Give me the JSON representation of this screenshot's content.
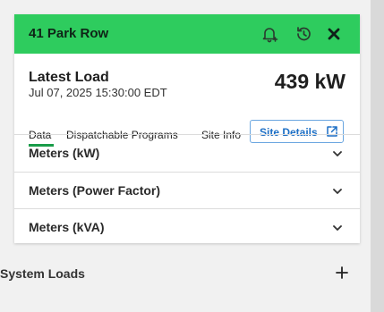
{
  "header": {
    "title": "41 Park Row",
    "accent_color": "#2ecc5e",
    "icons": [
      "bell-plus-icon",
      "history-icon",
      "close-icon"
    ]
  },
  "latest_load": {
    "title": "Latest Load",
    "timestamp": "Jul 07, 2025 15:30:00 EDT",
    "value": "439 kW"
  },
  "tabs": [
    {
      "label": "Data",
      "active": true
    },
    {
      "label": "Dispatchable Programs",
      "active": false
    },
    {
      "label": "Site Info",
      "active": false
    }
  ],
  "site_details_button": {
    "label": "Site Details",
    "icon": "external-link-icon"
  },
  "accordions": [
    {
      "label": "Meters (kW)",
      "icon": "chevron-down-icon"
    },
    {
      "label": "Meters (Power Factor)",
      "icon": "chevron-down-icon"
    },
    {
      "label": "Meters (kVA)",
      "icon": "chevron-down-icon"
    }
  ],
  "system_loads": {
    "label": "System Loads",
    "icon": "plus-icon"
  }
}
